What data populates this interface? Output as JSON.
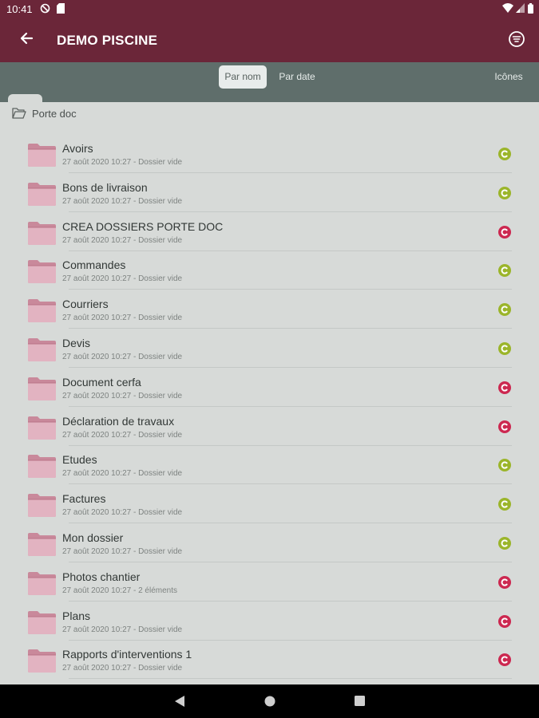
{
  "status_bar": {
    "time": "10:41",
    "icons": [
      "sync-icon",
      "sd-card-icon",
      "wifi-icon",
      "signal-icon",
      "battery-icon"
    ]
  },
  "app_bar": {
    "title": "DEMO PISCINE",
    "back_icon": "arrow-left-icon",
    "menu_icon": "filter-list-icon",
    "background": "#6b2639"
  },
  "toolbar": {
    "sort_by_name": "Par nom",
    "sort_by_date": "Par date",
    "view_mode": "Icônes",
    "active_sort": "Par nom"
  },
  "breadcrumb": {
    "icon": "folder-open-icon",
    "label": "Porte doc"
  },
  "folders": [
    {
      "name": "Avoirs",
      "meta": "27 août 2020 10:27 - Dossier vide",
      "status": "green"
    },
    {
      "name": "Bons de livraison",
      "meta": "27 août 2020 10:27 - Dossier vide",
      "status": "green"
    },
    {
      "name": "CREA DOSSIERS PORTE DOC",
      "meta": "27 août 2020 10:27 - Dossier vide",
      "status": "red"
    },
    {
      "name": "Commandes",
      "meta": "27 août 2020 10:27 - Dossier vide",
      "status": "green"
    },
    {
      "name": "Courriers",
      "meta": "27 août 2020 10:27 - Dossier vide",
      "status": "green"
    },
    {
      "name": "Devis",
      "meta": "27 août 2020 10:27 - Dossier vide",
      "status": "green"
    },
    {
      "name": "Document cerfa",
      "meta": "27 août 2020 10:27 - Dossier vide",
      "status": "red"
    },
    {
      "name": "Déclaration de travaux",
      "meta": "27 août 2020 10:27 - Dossier vide",
      "status": "red"
    },
    {
      "name": "Etudes",
      "meta": "27 août 2020 10:27 - Dossier vide",
      "status": "green"
    },
    {
      "name": "Factures",
      "meta": "27 août 2020 10:27 - Dossier vide",
      "status": "green"
    },
    {
      "name": "Mon dossier",
      "meta": "27 août 2020 10:27 - Dossier vide",
      "status": "green"
    },
    {
      "name": "Photos chantier",
      "meta": "27 août 2020 10:27 - 2 éléments",
      "status": "red"
    },
    {
      "name": "Plans",
      "meta": "27 août 2020 10:27 - Dossier vide",
      "status": "red"
    },
    {
      "name": "Rapports d'interventions 1",
      "meta": "27 août 2020 10:27 - Dossier vide",
      "status": "red"
    }
  ],
  "status_colors": {
    "green": "#9bb52a",
    "red": "#cc2850"
  },
  "nav_bar": {
    "icons": [
      "back-triangle-icon",
      "home-circle-icon",
      "recents-square-icon"
    ]
  }
}
